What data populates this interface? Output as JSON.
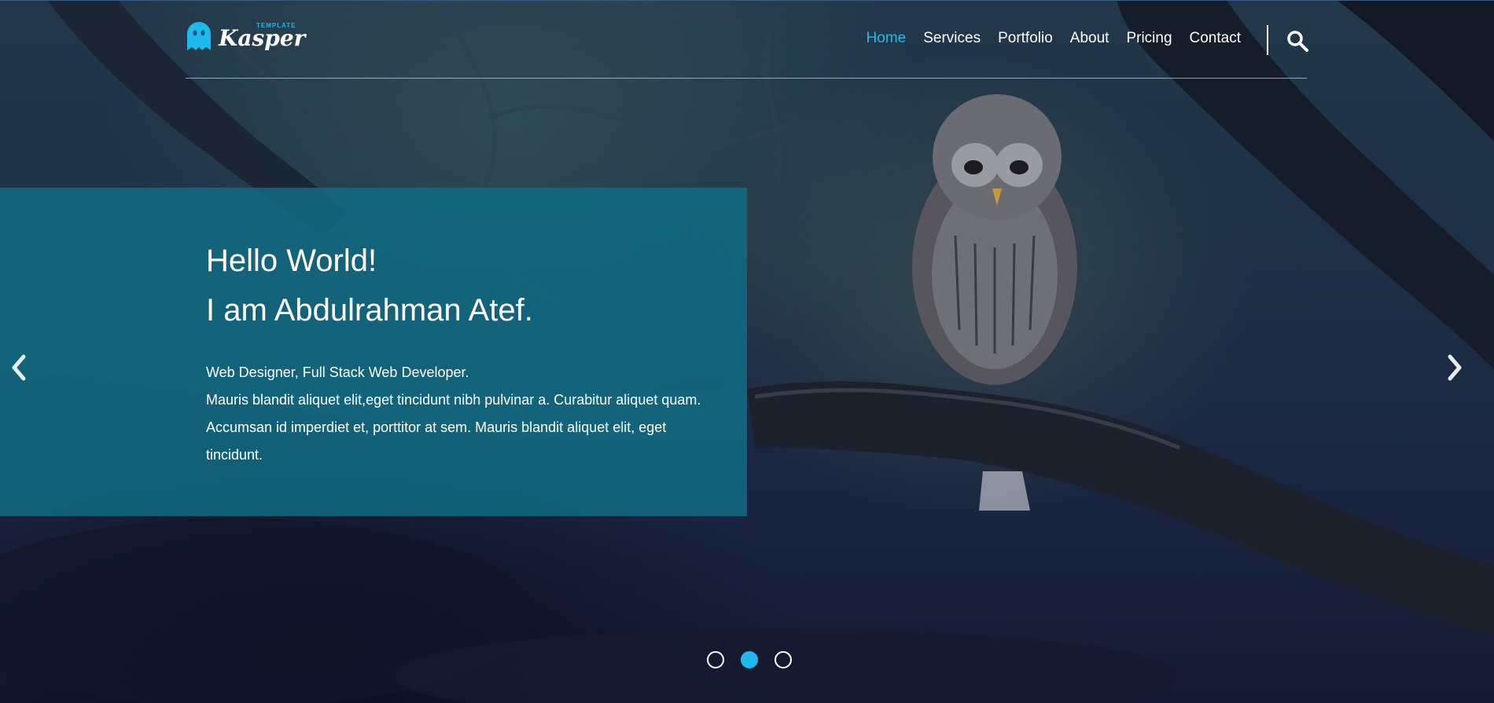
{
  "brand": {
    "name": "Kasper",
    "tag": "TEMPLATE",
    "accent_color": "#1fb9ed"
  },
  "nav": {
    "items": [
      {
        "label": "Home",
        "active": true
      },
      {
        "label": "Services",
        "active": false
      },
      {
        "label": "Portfolio",
        "active": false
      },
      {
        "label": "About",
        "active": false
      },
      {
        "label": "Pricing",
        "active": false
      },
      {
        "label": "Contact",
        "active": false
      }
    ],
    "search_icon": "search-icon"
  },
  "slide": {
    "heading_line1": "Hello World!",
    "heading_line2": "I am Abdulrahman Atef.",
    "desc_line1": "Web Designer, Full Stack Web Developer.",
    "desc_body": "Mauris blandit aliquet elit,eget tincidunt nibh pulvinar a. Curabitur aliquet quam. Accumsan id imperdiet et, porttitor at sem. Mauris blandit aliquet elit, eget tincidunt.",
    "panel_color": "#106e85"
  },
  "carousel": {
    "prev_icon": "chevron-left-icon",
    "next_icon": "chevron-right-icon",
    "slide_count": 3,
    "active_index": 1
  }
}
